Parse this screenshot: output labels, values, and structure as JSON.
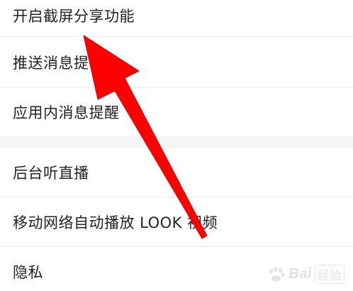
{
  "settings": {
    "group1": [
      {
        "label": "开启截屏分享功能"
      },
      {
        "label": "推送消息提"
      },
      {
        "label": "应用内消息提醒"
      }
    ],
    "group2": [
      {
        "label": "后台听直播"
      },
      {
        "label": "移动网络自动播放 LOOK 视频"
      },
      {
        "label": "隐私"
      }
    ]
  },
  "annotation": {
    "arrow_color": "#ff0000"
  },
  "watermark": {
    "brand": "Bai",
    "suffix": "经验"
  }
}
